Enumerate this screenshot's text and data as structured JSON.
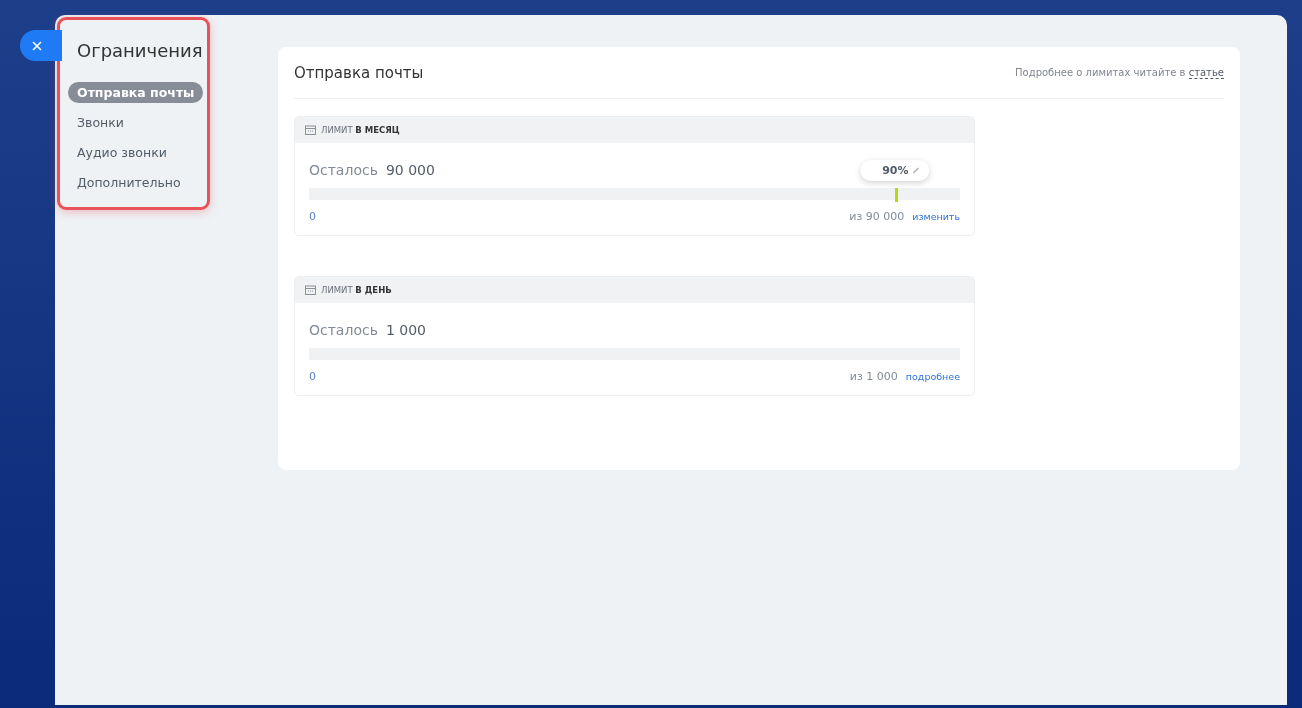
{
  "menu": {
    "title": "Ограничения",
    "items": [
      {
        "label": "Отправка почты",
        "selected": true
      },
      {
        "label": "Звонки",
        "selected": false
      },
      {
        "label": "Аудио звонки",
        "selected": false
      },
      {
        "label": "Дополнительно",
        "selected": false
      }
    ]
  },
  "section": {
    "title": "Отправка почты",
    "note": "Подробнее о лимитах читайте в",
    "note_link": "статье"
  },
  "limits": [
    {
      "title": "ЛИМИТ **В МЕСЯЦ**",
      "remaining_label": "Осталось",
      "remaining_value": "90 000",
      "threshold": {
        "label": "90%",
        "level": 0.9
      },
      "min": "0",
      "max": "из 90 000",
      "action": "изменить"
    },
    {
      "title": "ЛИМИТ **В ДЕНЬ**",
      "remaining_label": "Осталось",
      "remaining_value": "1 000",
      "min": "0",
      "max": "из 1 000",
      "action": "подробнее"
    }
  ]
}
